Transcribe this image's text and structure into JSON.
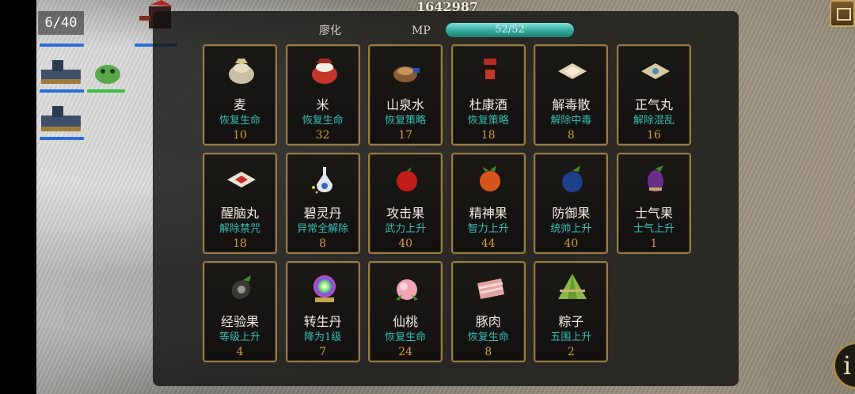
{
  "hud": {
    "score": "1642987",
    "unit_count": "6/40"
  },
  "header": {
    "character_name": "廖化",
    "mp_label": "MP",
    "mp_value": "52/52",
    "mp_fill": 1.0
  },
  "colors": {
    "card_border": "#9a7c42",
    "effect_text": "#36bdb1",
    "quantity_text": "#d59a3e",
    "mp_bar": "#2fa597"
  },
  "items": [
    {
      "name": "麦",
      "effect": "恢复生命",
      "qty": "10",
      "icon": "grain-sack-icon"
    },
    {
      "name": "米",
      "effect": "恢复生命",
      "qty": "32",
      "icon": "rice-bag-icon"
    },
    {
      "name": "山泉水",
      "effect": "恢复策略",
      "qty": "17",
      "icon": "water-gourd-icon"
    },
    {
      "name": "杜康酒",
      "effect": "恢复策略",
      "qty": "18",
      "icon": "wine-jar-icon"
    },
    {
      "name": "解毒散",
      "effect": "解除中毒",
      "qty": "8",
      "icon": "powder-packet-icon"
    },
    {
      "name": "正气丸",
      "effect": "解除混乱",
      "qty": "16",
      "icon": "pill-packet-icon"
    },
    {
      "name": "醒脑丸",
      "effect": "解除禁咒",
      "qty": "18",
      "icon": "red-pill-packet-icon"
    },
    {
      "name": "碧灵丹",
      "effect": "异常全解除",
      "qty": "8",
      "icon": "porcelain-vase-icon"
    },
    {
      "name": "攻击果",
      "effect": "武力上升",
      "qty": "40",
      "icon": "red-fruit-icon"
    },
    {
      "name": "精神果",
      "effect": "智力上升",
      "qty": "44",
      "icon": "orange-fruit-icon"
    },
    {
      "name": "防御果",
      "effect": "统帅上升",
      "qty": "40",
      "icon": "blue-fruit-icon"
    },
    {
      "name": "士气果",
      "effect": "士气上升",
      "qty": "1",
      "icon": "purple-fruit-icon"
    },
    {
      "name": "经验果",
      "effect": "等级上升",
      "qty": "4",
      "icon": "dark-fruit-icon"
    },
    {
      "name": "转生丹",
      "effect": "降为1级",
      "qty": "7",
      "icon": "rainbow-orb-icon"
    },
    {
      "name": "仙桃",
      "effect": "恢复生命",
      "qty": "24",
      "icon": "peach-icon"
    },
    {
      "name": "豚肉",
      "effect": "恢复生命",
      "qty": "8",
      "icon": "pork-icon"
    },
    {
      "name": "粽子",
      "effect": "五围上升",
      "qty": "2",
      "icon": "rice-dumpling-icon"
    }
  ]
}
